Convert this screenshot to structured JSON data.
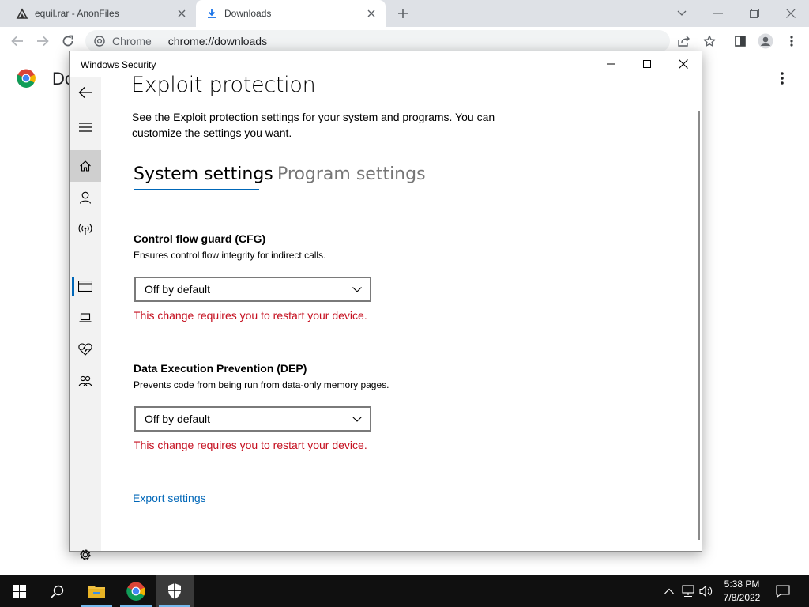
{
  "browser": {
    "tabs": [
      {
        "title": "equil.rar - AnonFiles",
        "icon": "anonfiles-icon"
      },
      {
        "title": "Downloads",
        "icon": "download-icon",
        "active": true
      }
    ],
    "address": {
      "chip": "Chrome",
      "url": "chrome://downloads"
    }
  },
  "downloads_page": {
    "title": "Do"
  },
  "windows_security": {
    "window_title": "Windows Security",
    "page_title": "Exploit protection",
    "description": "See the Exploit protection settings for your system and programs.  You can customize the settings you want.",
    "tabs": [
      {
        "label": "System settings",
        "selected": true
      },
      {
        "label": "Program settings",
        "selected": false
      }
    ],
    "sections": [
      {
        "title": "Control flow guard (CFG)",
        "description": "Ensures control flow integrity for indirect calls.",
        "value": "Off by default",
        "warning": "This change requires you to restart your device."
      },
      {
        "title": "Data Execution Prevention (DEP)",
        "description": "Prevents code from being run from data-only memory pages.",
        "value": "Off by default",
        "warning": "This change requires you to restart your device."
      }
    ],
    "export_link": "Export settings",
    "nav": [
      "back-icon",
      "hamburger-icon",
      "home-icon",
      "account-icon",
      "network-icon",
      "app-browser-icon",
      "device-security-icon",
      "health-icon",
      "family-icon",
      "settings-icon"
    ],
    "accent_color": "#0067b8",
    "warning_color": "#c50f1f"
  },
  "taskbar": {
    "time": "5:38 PM",
    "date": "7/8/2022"
  }
}
